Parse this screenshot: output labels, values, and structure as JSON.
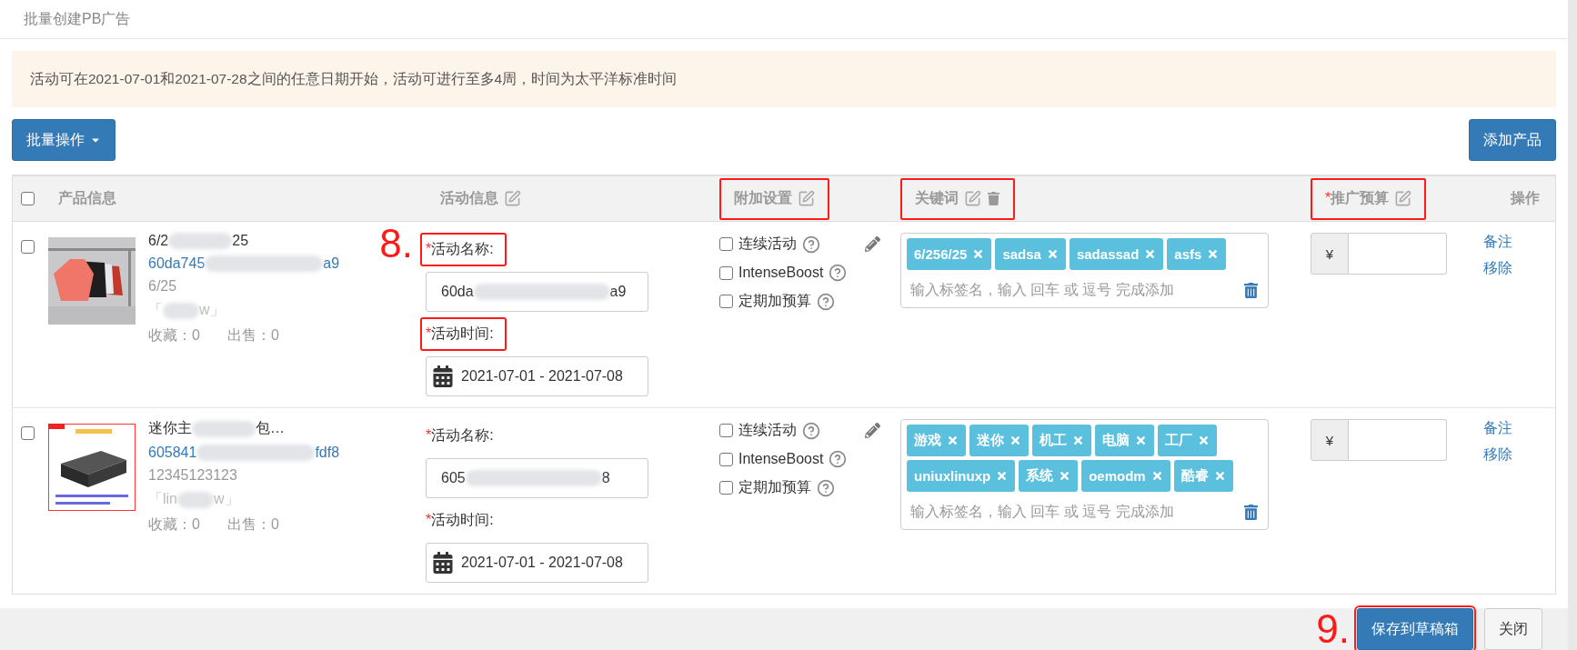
{
  "page_title": "批量创建PB广告",
  "notice": "活动可在2021-07-01和2021-07-28之间的任意日期开始，活动可进行至多4周，时间为太平洋标准时间",
  "toolbar": {
    "bulk_button": "批量操作",
    "add_button": "添加产品"
  },
  "table": {
    "select_all_checked": false,
    "columns": [
      {
        "label": "产品信息",
        "kind": "plain",
        "annotated": false
      },
      {
        "label": "活动信息",
        "kind": "editable",
        "annotated": false
      },
      {
        "label": "附加设置",
        "kind": "editable",
        "annotated": true
      },
      {
        "label": "关键词",
        "kind": "editable_deletable",
        "annotated": true
      },
      {
        "label": "推广预算",
        "required_mark": "*",
        "kind": "editable",
        "annotated": true
      },
      {
        "label": "操作",
        "kind": "plain",
        "annotated": false
      }
    ],
    "rows": [
      {
        "checked": false,
        "image": {
          "kind": "picture"
        },
        "name_parts": [
          "6/2",
          "25"
        ],
        "id_parts": [
          "60da745",
          "a9"
        ],
        "sku": "6/25",
        "shop_parts": [
          "「",
          "w」"
        ],
        "stats": [
          "收藏：0",
          "出售：0"
        ],
        "annotation": "8.",
        "campaign_name": {
          "label": "活动名称:",
          "required_mark": "*",
          "annotated": true,
          "value_parts": [
            "60da",
            "a9"
          ]
        },
        "campaign_time": {
          "label": "活动时间:",
          "required_mark": "*",
          "annotated": true,
          "value": "2021-07-01 - 2021-07-08"
        },
        "options": [
          {
            "label": "连续活动",
            "checked": false
          },
          {
            "label": "IntenseBoost",
            "checked": false
          },
          {
            "label": "定期加预算",
            "checked": false
          }
        ],
        "keywords": [
          "6/256/25",
          "sadsa",
          "sadassad",
          "asfs"
        ],
        "keyword_placeholder": "输入标签名，输入 回车 或 逗号 完成添加",
        "budget_currency": "¥",
        "actions": [
          "备注",
          "移除"
        ]
      },
      {
        "checked": false,
        "image": {
          "kind": "picture"
        },
        "name_parts": [
          "迷你主",
          "包…"
        ],
        "id_parts": [
          "605841",
          "fdf8"
        ],
        "sku": "12345123123",
        "shop_parts": [
          "「lin",
          "w」"
        ],
        "stats": [
          "收藏：0",
          "出售：0"
        ],
        "campaign_name": {
          "label": "活动名称:",
          "required_mark": "*",
          "annotated": false,
          "value_parts": [
            "605",
            "8"
          ]
        },
        "campaign_time": {
          "label": "活动时间:",
          "required_mark": "*",
          "annotated": false,
          "value": "2021-07-01 - 2021-07-08"
        },
        "options": [
          {
            "label": "连续活动",
            "checked": false
          },
          {
            "label": "IntenseBoost",
            "checked": false
          },
          {
            "label": "定期加预算",
            "checked": false
          }
        ],
        "keywords": [
          "游戏",
          "迷你",
          "机工",
          "电脑",
          "工厂",
          "uniuxlinuxp",
          "系统",
          "oemodm",
          "酷睿"
        ],
        "keyword_placeholder": "输入标签名，输入 回车 或 逗号 完成添加",
        "budget_currency": "¥",
        "actions": [
          "备注",
          "移除"
        ]
      }
    ]
  },
  "footer": {
    "buttons": [
      {
        "label": "保存到草稿箱",
        "kind": "primary",
        "annotated": true,
        "annotation": "9."
      },
      {
        "label": "关闭",
        "kind": "default",
        "annotated": false
      }
    ]
  }
}
